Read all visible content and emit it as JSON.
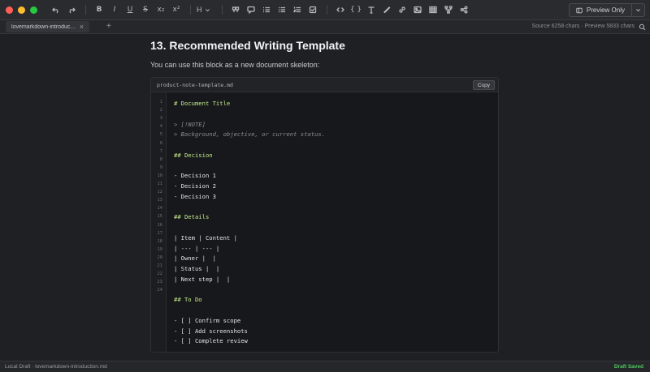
{
  "toolbar": {
    "heading_label": "H",
    "preview_label": "Preview Only"
  },
  "tabs": {
    "active_label": "lovemarkdown-introduction.md",
    "stats": "Source 6258 chars · Preview 5833 chars"
  },
  "content": {
    "heading": "13. Recommended Writing Template",
    "paragraph": "You can use this block as a new document skeleton:",
    "code": {
      "filename": "product-note-template.md",
      "copy_label": "Copy",
      "line_numbers": [
        "1",
        "2",
        "3",
        "4",
        "5",
        "6",
        "7",
        "8",
        "9",
        "10",
        "11",
        "12",
        "13",
        "14",
        "15",
        "16",
        "17",
        "18",
        "19",
        "20",
        "21",
        "22",
        "23",
        "24"
      ],
      "lines": [
        {
          "text": "# Document Title",
          "kind": "heading"
        },
        {
          "text": "",
          "kind": "text"
        },
        {
          "text": "> [!NOTE]",
          "kind": "quote"
        },
        {
          "text": "> Background, objective, or current status.",
          "kind": "quote"
        },
        {
          "text": "",
          "kind": "text"
        },
        {
          "text": "## Decision",
          "kind": "heading"
        },
        {
          "text": "",
          "kind": "text"
        },
        {
          "text": "- Decision 1",
          "kind": "text"
        },
        {
          "text": "- Decision 2",
          "kind": "text"
        },
        {
          "text": "- Decision 3",
          "kind": "text"
        },
        {
          "text": "",
          "kind": "text"
        },
        {
          "text": "## Details",
          "kind": "heading"
        },
        {
          "text": "",
          "kind": "text"
        },
        {
          "text": "| Item | Content |",
          "kind": "text"
        },
        {
          "text": "| --- | --- |",
          "kind": "text"
        },
        {
          "text": "| Owner |  |",
          "kind": "text"
        },
        {
          "text": "| Status |  |",
          "kind": "text"
        },
        {
          "text": "| Next step |  |",
          "kind": "text"
        },
        {
          "text": "",
          "kind": "text"
        },
        {
          "text": "## To Do",
          "kind": "heading"
        },
        {
          "text": "",
          "kind": "text"
        },
        {
          "text": "- [ ] Confirm scope",
          "kind": "text"
        },
        {
          "text": "- [ ] Add screenshots",
          "kind": "text"
        },
        {
          "text": "- [ ] Complete review",
          "kind": "text"
        }
      ]
    }
  },
  "status": {
    "left": "Local Draft · lovemarkdown-introduction.md",
    "right": "Draft Saved"
  },
  "colors": {
    "accent_green": "#4ec95e",
    "heading_code": "#c3e88d"
  }
}
